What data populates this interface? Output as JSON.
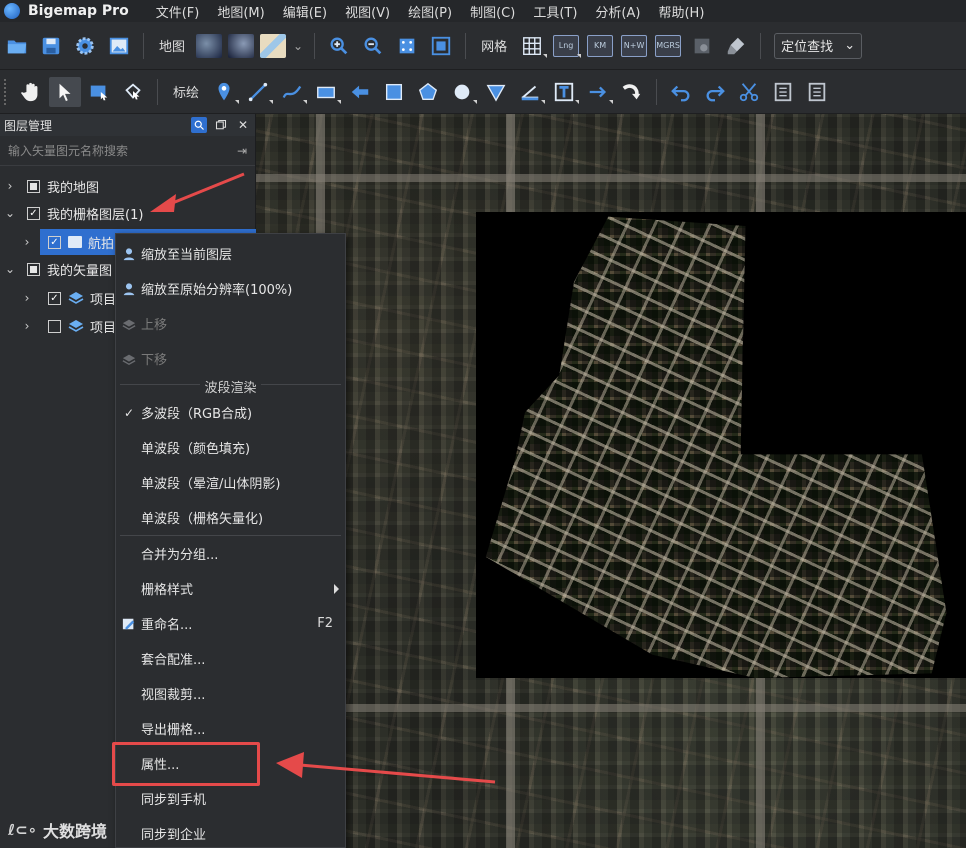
{
  "app": {
    "title": "Bigemap Pro"
  },
  "menu": [
    "文件(F)",
    "地图(M)",
    "编辑(E)",
    "视图(V)",
    "绘图(P)",
    "制图(C)",
    "工具(T)",
    "分析(A)",
    "帮助(H)"
  ],
  "toolbar1": {
    "map_label": "地图",
    "grid_label": "网格",
    "badges": [
      "Lng",
      "KM",
      "N+W",
      "MGRS"
    ],
    "locate_select": "定位查找",
    "icons": [
      "open-folder-icon",
      "save-icon",
      "settings-gear-icon",
      "image-icon",
      "zoom-in-icon",
      "zoom-out-icon",
      "zoom-extent-icon",
      "full-extent-icon",
      "grid-icon",
      "erase-brush-icon"
    ]
  },
  "toolbar2": {
    "draw_label": "标绘",
    "icons": [
      "pan-hand-icon",
      "select-arrow-icon",
      "image-select-icon",
      "node-edit-icon",
      "marker-icon",
      "line-icon",
      "curve-icon",
      "rectangle-icon",
      "arrow-shape-icon",
      "square-icon",
      "pentagon-icon",
      "circle-icon",
      "sector-icon",
      "measure-icon",
      "text-icon",
      "straight-arrow-icon",
      "curved-arrow-icon",
      "undo-icon",
      "redo-icon",
      "cut-icon",
      "attribute-icon"
    ]
  },
  "panel": {
    "title": "图层管理",
    "search_placeholder": "输入矢量图元名称搜索",
    "tree": [
      {
        "label": "我的地图",
        "expanded": false,
        "check": "partial"
      },
      {
        "label": "我的栅格图层(1)",
        "expanded": true,
        "check": "checked"
      },
      {
        "label": "航拍",
        "expanded": false,
        "check": "checked",
        "selected": true
      },
      {
        "label": "我的矢量图",
        "expanded": true,
        "check": "partial"
      },
      {
        "label": "项目",
        "expanded": false,
        "check": "checked"
      },
      {
        "label": "项目",
        "expanded": false,
        "check": "unchecked"
      }
    ]
  },
  "context_menu": {
    "items": [
      {
        "label": "缩放至当前图层",
        "icon": "pin-icon",
        "enabled": true
      },
      {
        "label": "缩放至原始分辨率(100%)",
        "icon": "pin-icon",
        "enabled": true
      },
      {
        "label": "上移",
        "icon": "layer-up-icon",
        "enabled": false
      },
      {
        "label": "下移",
        "icon": "layer-down-icon",
        "enabled": false
      }
    ],
    "band_header": "波段渲染",
    "band_items": [
      {
        "label": "多波段（RGB合成)",
        "checked": true
      },
      {
        "label": "单波段（颜色填充)",
        "checked": false
      },
      {
        "label": "单波段（晕渲/山体阴影)",
        "checked": false
      },
      {
        "label": "单波段（栅格矢量化)",
        "checked": false
      }
    ],
    "more_items": [
      {
        "label": "合并为分组...",
        "shortcut": ""
      },
      {
        "label": "栅格样式",
        "shortcut": "",
        "submenu": true
      },
      {
        "label": "重命名...",
        "shortcut": "F2",
        "icon": "rename-icon"
      },
      {
        "label": "套合配准...",
        "shortcut": ""
      },
      {
        "label": "视图裁剪...",
        "shortcut": ""
      },
      {
        "label": "导出栅格...",
        "shortcut": ""
      },
      {
        "label": "属性...",
        "shortcut": "",
        "highlighted": true
      },
      {
        "label": "同步到手机",
        "shortcut": ""
      },
      {
        "label": "同步到企业",
        "shortcut": ""
      }
    ]
  },
  "colors": {
    "accent": "#2f6fcf",
    "annotation": "#e54a4a",
    "bg": "#2b2d30"
  },
  "watermark": {
    "text": "大数跨境"
  }
}
